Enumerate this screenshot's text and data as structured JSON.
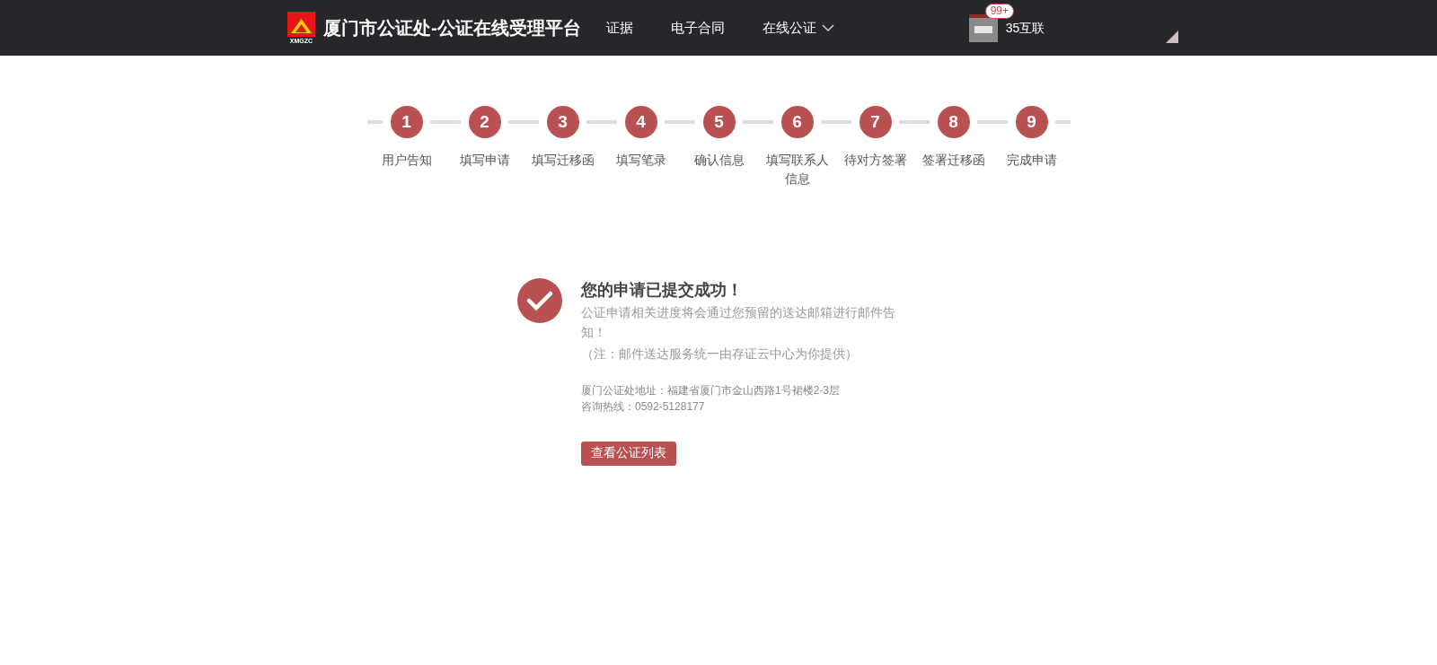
{
  "header": {
    "logo_text": "XMGZC",
    "title": "厦门市公证处-公证在线受理平台",
    "nav": [
      {
        "label": "证据",
        "dropdown": false
      },
      {
        "label": "电子合同",
        "dropdown": false
      },
      {
        "label": "在线公证",
        "dropdown": true
      }
    ],
    "user": {
      "badge": "99+",
      "name": "35互联"
    }
  },
  "steps": [
    {
      "number": "1",
      "label": "用户告知"
    },
    {
      "number": "2",
      "label": "填写申请"
    },
    {
      "number": "3",
      "label": "填写迁移函"
    },
    {
      "number": "4",
      "label": "填写笔录"
    },
    {
      "number": "5",
      "label": "确认信息"
    },
    {
      "number": "6",
      "label": "填写联系人信息"
    },
    {
      "number": "7",
      "label": "待对方签署"
    },
    {
      "number": "8",
      "label": "签署迁移函"
    },
    {
      "number": "9",
      "label": "完成申请"
    }
  ],
  "result": {
    "title": "您的申请已提交成功！",
    "message": "公证申请相关进度将会通过您预留的送达邮箱进行邮件告知！",
    "note": "（注：邮件送达服务统一由存证云中心为你提供）",
    "address": "厦门公证处地址：福建省厦门市金山西路1号裙楼2-3层",
    "hotline": "咨询热线：0592-5128177",
    "button": "查看公证列表"
  }
}
